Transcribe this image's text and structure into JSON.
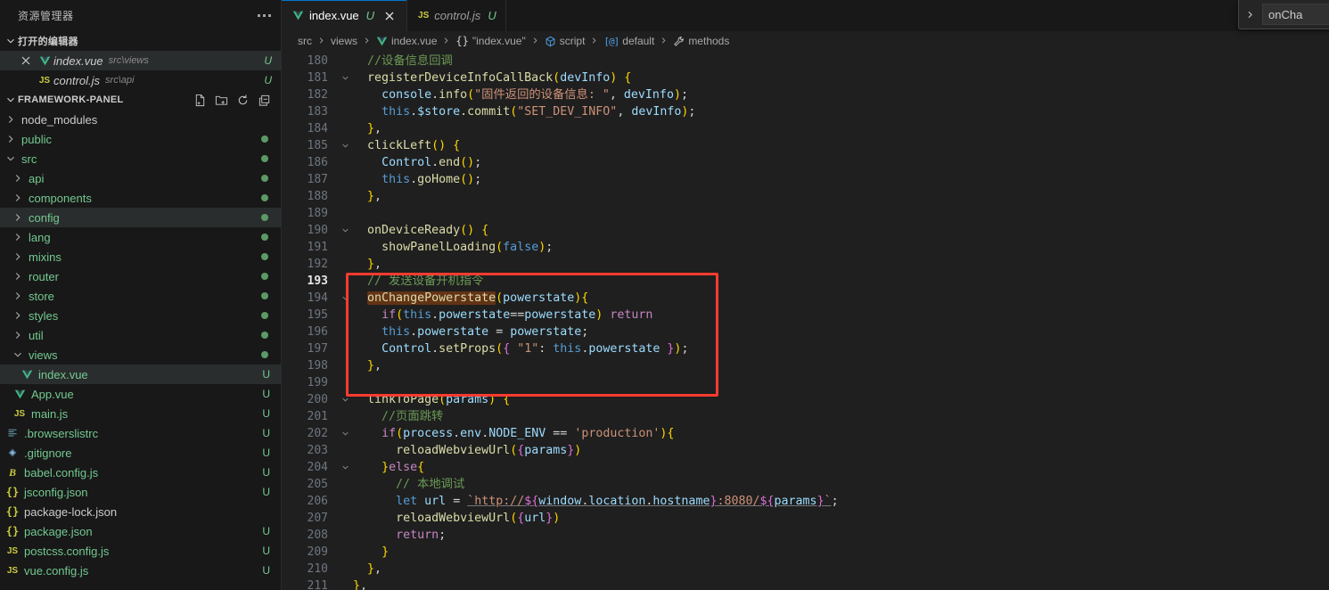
{
  "sidebar": {
    "title": "资源管理器",
    "kebab_name": "more-actions",
    "open_editors": {
      "label": "打开的编辑器",
      "items": [
        {
          "icon": "vue-file-icon",
          "name": "index.vue",
          "path": "src\\views",
          "badge": "U",
          "active": true,
          "closable": true
        },
        {
          "icon": "js-file-icon",
          "name": "control.js",
          "path": "src\\api",
          "badge": "U",
          "active": false,
          "closable": false
        }
      ]
    },
    "explorer": {
      "label": "FRAMEWORK-PANEL",
      "actions": [
        "new-file-icon",
        "new-folder-icon",
        "refresh-icon",
        "collapse-all-icon"
      ],
      "tree": [
        {
          "label": "node_modules",
          "kind": "folder",
          "expanded": false,
          "depth": 0,
          "color": "plain",
          "dot": false,
          "badge": ""
        },
        {
          "label": "public",
          "kind": "folder",
          "expanded": false,
          "depth": 0,
          "color": "mod",
          "dot": true,
          "badge": ""
        },
        {
          "label": "src",
          "kind": "folder",
          "expanded": true,
          "depth": 0,
          "color": "mod",
          "dot": true,
          "badge": ""
        },
        {
          "label": "api",
          "kind": "folder",
          "expanded": false,
          "depth": 1,
          "color": "mod",
          "dot": true,
          "badge": ""
        },
        {
          "label": "components",
          "kind": "folder",
          "expanded": false,
          "depth": 1,
          "color": "mod",
          "dot": true,
          "badge": ""
        },
        {
          "label": "config",
          "kind": "folder",
          "expanded": false,
          "depth": 1,
          "color": "mod",
          "dot": true,
          "badge": "",
          "selected": true
        },
        {
          "label": "lang",
          "kind": "folder",
          "expanded": false,
          "depth": 1,
          "color": "mod",
          "dot": true,
          "badge": ""
        },
        {
          "label": "mixins",
          "kind": "folder",
          "expanded": false,
          "depth": 1,
          "color": "mod",
          "dot": true,
          "badge": ""
        },
        {
          "label": "router",
          "kind": "folder",
          "expanded": false,
          "depth": 1,
          "color": "mod",
          "dot": true,
          "badge": ""
        },
        {
          "label": "store",
          "kind": "folder",
          "expanded": false,
          "depth": 1,
          "color": "mod",
          "dot": true,
          "badge": ""
        },
        {
          "label": "styles",
          "kind": "folder",
          "expanded": false,
          "depth": 1,
          "color": "mod",
          "dot": true,
          "badge": ""
        },
        {
          "label": "util",
          "kind": "folder",
          "expanded": false,
          "depth": 1,
          "color": "mod",
          "dot": true,
          "badge": ""
        },
        {
          "label": "views",
          "kind": "folder",
          "expanded": true,
          "depth": 1,
          "color": "mod",
          "dot": true,
          "badge": ""
        },
        {
          "label": "index.vue",
          "kind": "file",
          "icon": "vue-file-icon",
          "depth": 2,
          "color": "mod",
          "dot": false,
          "badge": "U",
          "selected": true
        },
        {
          "label": "App.vue",
          "kind": "file",
          "icon": "vue-file-icon",
          "depth": 1,
          "color": "mod",
          "dot": false,
          "badge": "U"
        },
        {
          "label": "main.js",
          "kind": "file",
          "icon": "js-file-icon",
          "depth": 1,
          "color": "mod",
          "dot": false,
          "badge": "U"
        },
        {
          "label": ".browserslistrc",
          "kind": "file",
          "icon": "config-file-icon",
          "depth": 0,
          "color": "mod",
          "dot": false,
          "badge": "U"
        },
        {
          "label": ".gitignore",
          "kind": "file",
          "icon": "git-file-icon",
          "depth": 0,
          "color": "mod",
          "dot": false,
          "badge": "U"
        },
        {
          "label": "babel.config.js",
          "kind": "file",
          "icon": "babel-file-icon",
          "depth": 0,
          "color": "mod",
          "dot": false,
          "badge": "U"
        },
        {
          "label": "jsconfig.json",
          "kind": "file",
          "icon": "json-file-icon",
          "depth": 0,
          "color": "mod",
          "dot": false,
          "badge": "U"
        },
        {
          "label": "package-lock.json",
          "kind": "file",
          "icon": "json-file-icon",
          "depth": 0,
          "color": "plain",
          "dot": false,
          "badge": ""
        },
        {
          "label": "package.json",
          "kind": "file",
          "icon": "json-file-icon",
          "depth": 0,
          "color": "mod",
          "dot": false,
          "badge": "U"
        },
        {
          "label": "postcss.config.js",
          "kind": "file",
          "icon": "js-file-icon",
          "depth": 0,
          "color": "mod",
          "dot": false,
          "badge": "U"
        },
        {
          "label": "vue.config.js",
          "kind": "file",
          "icon": "js-file-icon",
          "depth": 0,
          "color": "mod",
          "dot": false,
          "badge": "U"
        }
      ]
    }
  },
  "tabs": [
    {
      "icon": "vue-file-icon",
      "label": "index.vue",
      "badge": "U",
      "active": true,
      "close": "×"
    },
    {
      "icon": "js-file-icon",
      "label": "control.js",
      "badge": "U",
      "active": false,
      "close": ""
    }
  ],
  "breadcrumb": [
    {
      "label": "src",
      "icon": ""
    },
    {
      "label": "views",
      "icon": ""
    },
    {
      "label": "index.vue",
      "icon": "vue-file-icon"
    },
    {
      "label": "\"index.vue\"",
      "icon": "braces-icon"
    },
    {
      "label": "script",
      "icon": "namespace-cube-icon"
    },
    {
      "label": "default",
      "icon": "object-icon"
    },
    {
      "label": "methods",
      "icon": "method-wrench-icon"
    }
  ],
  "find_widget": {
    "toggle_icon": "chevron-right-icon",
    "query": "onCha"
  },
  "editor": {
    "first_line": 180,
    "current_line": 193,
    "highlight_box": {
      "from_line": 193,
      "to_line": 199
    },
    "fold_lines": [
      181,
      185,
      190,
      194,
      200,
      202,
      204
    ],
    "lines": [
      {
        "n": 180,
        "text": "  //设备信息回调"
      },
      {
        "n": 181,
        "text": "  registerDeviceInfoCallBack(devInfo) {"
      },
      {
        "n": 182,
        "text": "    console.info(\"固件返回的设备信息: \", devInfo);"
      },
      {
        "n": 183,
        "text": "    this.$store.commit(\"SET_DEV_INFO\", devInfo);"
      },
      {
        "n": 184,
        "text": "  },"
      },
      {
        "n": 185,
        "text": "  clickLeft() {"
      },
      {
        "n": 186,
        "text": "    Control.end();"
      },
      {
        "n": 187,
        "text": "    this.goHome();"
      },
      {
        "n": 188,
        "text": "  },"
      },
      {
        "n": 189,
        "text": ""
      },
      {
        "n": 190,
        "text": "  onDeviceReady() {"
      },
      {
        "n": 191,
        "text": "    showPanelLoading(false);"
      },
      {
        "n": 192,
        "text": "  },"
      },
      {
        "n": 193,
        "text": "  // 发送设备开机指令"
      },
      {
        "n": 194,
        "text": "  onChangePowerstate(powerstate){"
      },
      {
        "n": 195,
        "text": "    if(this.powerstate==powerstate) return"
      },
      {
        "n": 196,
        "text": "    this.powerstate = powerstate;"
      },
      {
        "n": 197,
        "text": "    Control.setProps({ \"1\": this.powerstate });"
      },
      {
        "n": 198,
        "text": "  },"
      },
      {
        "n": 199,
        "text": ""
      },
      {
        "n": 200,
        "text": "  linkToPage(params) {"
      },
      {
        "n": 201,
        "text": "    //页面跳转"
      },
      {
        "n": 202,
        "text": "    if(process.env.NODE_ENV == 'production'){"
      },
      {
        "n": 203,
        "text": "      reloadWebviewUrl({params})"
      },
      {
        "n": 204,
        "text": "    }else{"
      },
      {
        "n": 205,
        "text": "      // 本地调试"
      },
      {
        "n": 206,
        "text": "      let url = `http://${window.location.hostname}:8080/${params}`;"
      },
      {
        "n": 207,
        "text": "      reloadWebviewUrl({url})"
      },
      {
        "n": 208,
        "text": "      return;"
      },
      {
        "n": 209,
        "text": "    }"
      },
      {
        "n": 210,
        "text": "  },"
      },
      {
        "n": 211,
        "text": "},"
      }
    ]
  },
  "colors": {
    "sidebar_bg": "#181818",
    "editor_bg": "#1f1f1f",
    "accent": "#0078d4",
    "modified_green": "#73c991",
    "highlight_box_red": "#ff3b30",
    "match_highlight": "#623315",
    "selection_row": "#2a2d2e"
  }
}
